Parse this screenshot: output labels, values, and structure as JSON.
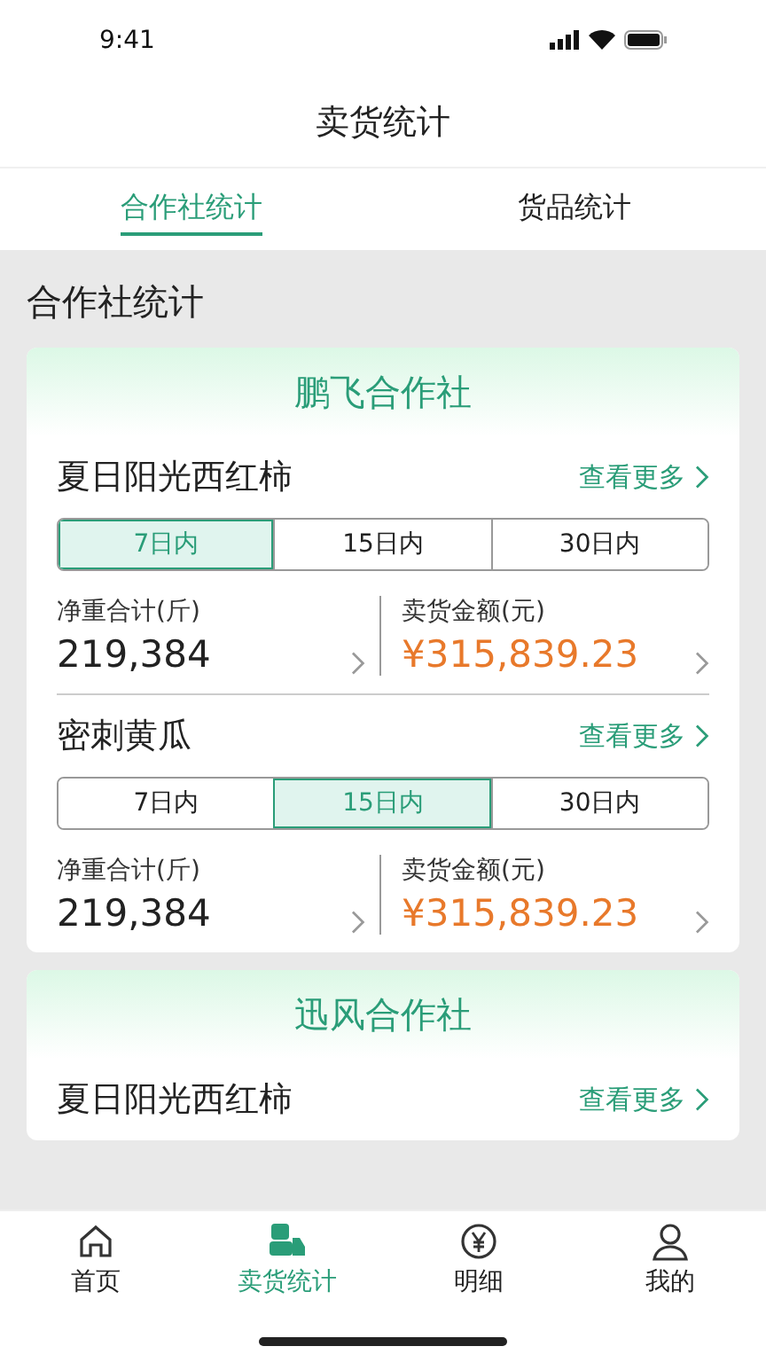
{
  "status_bar": {
    "time": "9:41"
  },
  "header": {
    "title": "卖货统计"
  },
  "tabs": [
    {
      "label": "合作社统计",
      "selected": true
    },
    {
      "label": "货品统计",
      "selected": false
    }
  ],
  "section_title": "合作社统计",
  "cooperatives": [
    {
      "name": "鹏飞合作社",
      "products": [
        {
          "name": "夏日阳光西红柿",
          "more": "查看更多",
          "periods": [
            {
              "label": "7日内",
              "selected": true
            },
            {
              "label": "15日内",
              "selected": false
            },
            {
              "label": "30日内",
              "selected": false
            }
          ],
          "weight_label": "净重合计(斤)",
          "weight": "219,384",
          "amount_label": "卖货金额(元)",
          "amount": "¥315,839.23"
        },
        {
          "name": "密刺黄瓜",
          "more": "查看更多",
          "periods": [
            {
              "label": "7日内",
              "selected": false
            },
            {
              "label": "15日内",
              "selected": true
            },
            {
              "label": "30日内",
              "selected": false
            }
          ],
          "weight_label": "净重合计(斤)",
          "weight": "219,384",
          "amount_label": "卖货金额(元)",
          "amount": "¥315,839.23"
        }
      ]
    },
    {
      "name": "迅风合作社",
      "products": [
        {
          "name": "夏日阳光西红柿",
          "more": "查看更多"
        }
      ]
    }
  ],
  "tab_bar": [
    {
      "kind": "home",
      "label": "首页",
      "selected": false
    },
    {
      "kind": "goods",
      "label": "卖货统计",
      "selected": true
    },
    {
      "kind": "money",
      "label": "明细",
      "selected": false
    },
    {
      "kind": "user",
      "label": "我的",
      "selected": false
    }
  ]
}
